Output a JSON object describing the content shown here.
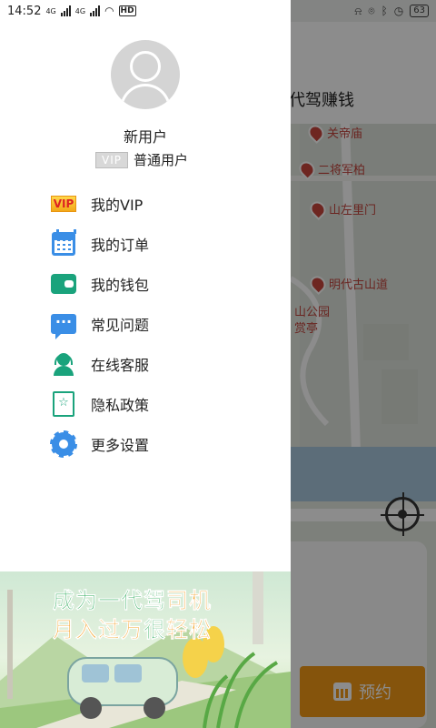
{
  "status_bar": {
    "time": "14:52",
    "network_1": "4G",
    "network_2": "4G",
    "hd_label": "HD",
    "battery": "63"
  },
  "background": {
    "title": "代驾赚钱",
    "pois": [
      "关帝庙",
      "二将军柏",
      "山左里门",
      "明代古山道",
      "山公园",
      "赏亭"
    ],
    "book_button": "预约"
  },
  "drawer": {
    "user": {
      "name": "新用户",
      "badge": "VIP",
      "level": "普通用户"
    },
    "menu": [
      {
        "label": "我的VIP",
        "icon": "vip-icon",
        "icon_text": "VIP"
      },
      {
        "label": "我的订单",
        "icon": "calendar-icon"
      },
      {
        "label": "我的钱包",
        "icon": "wallet-icon"
      },
      {
        "label": "常见问题",
        "icon": "chat-bubble-icon"
      },
      {
        "label": "在线客服",
        "icon": "customer-service-icon"
      },
      {
        "label": "隐私政策",
        "icon": "privacy-book-icon"
      },
      {
        "label": "更多设置",
        "icon": "gear-icon"
      }
    ],
    "banner": {
      "line1_green": "成为一代驾",
      "line1_orange": "司机",
      "line2_orange_a": "月入过万",
      "line2_green": "很",
      "line2_orange_b": "轻松"
    }
  },
  "colors": {
    "accent_blue": "#3a8ee6",
    "accent_green": "#1aa37c",
    "accent_orange": "#f39a17",
    "poi_red": "#c8463d"
  }
}
